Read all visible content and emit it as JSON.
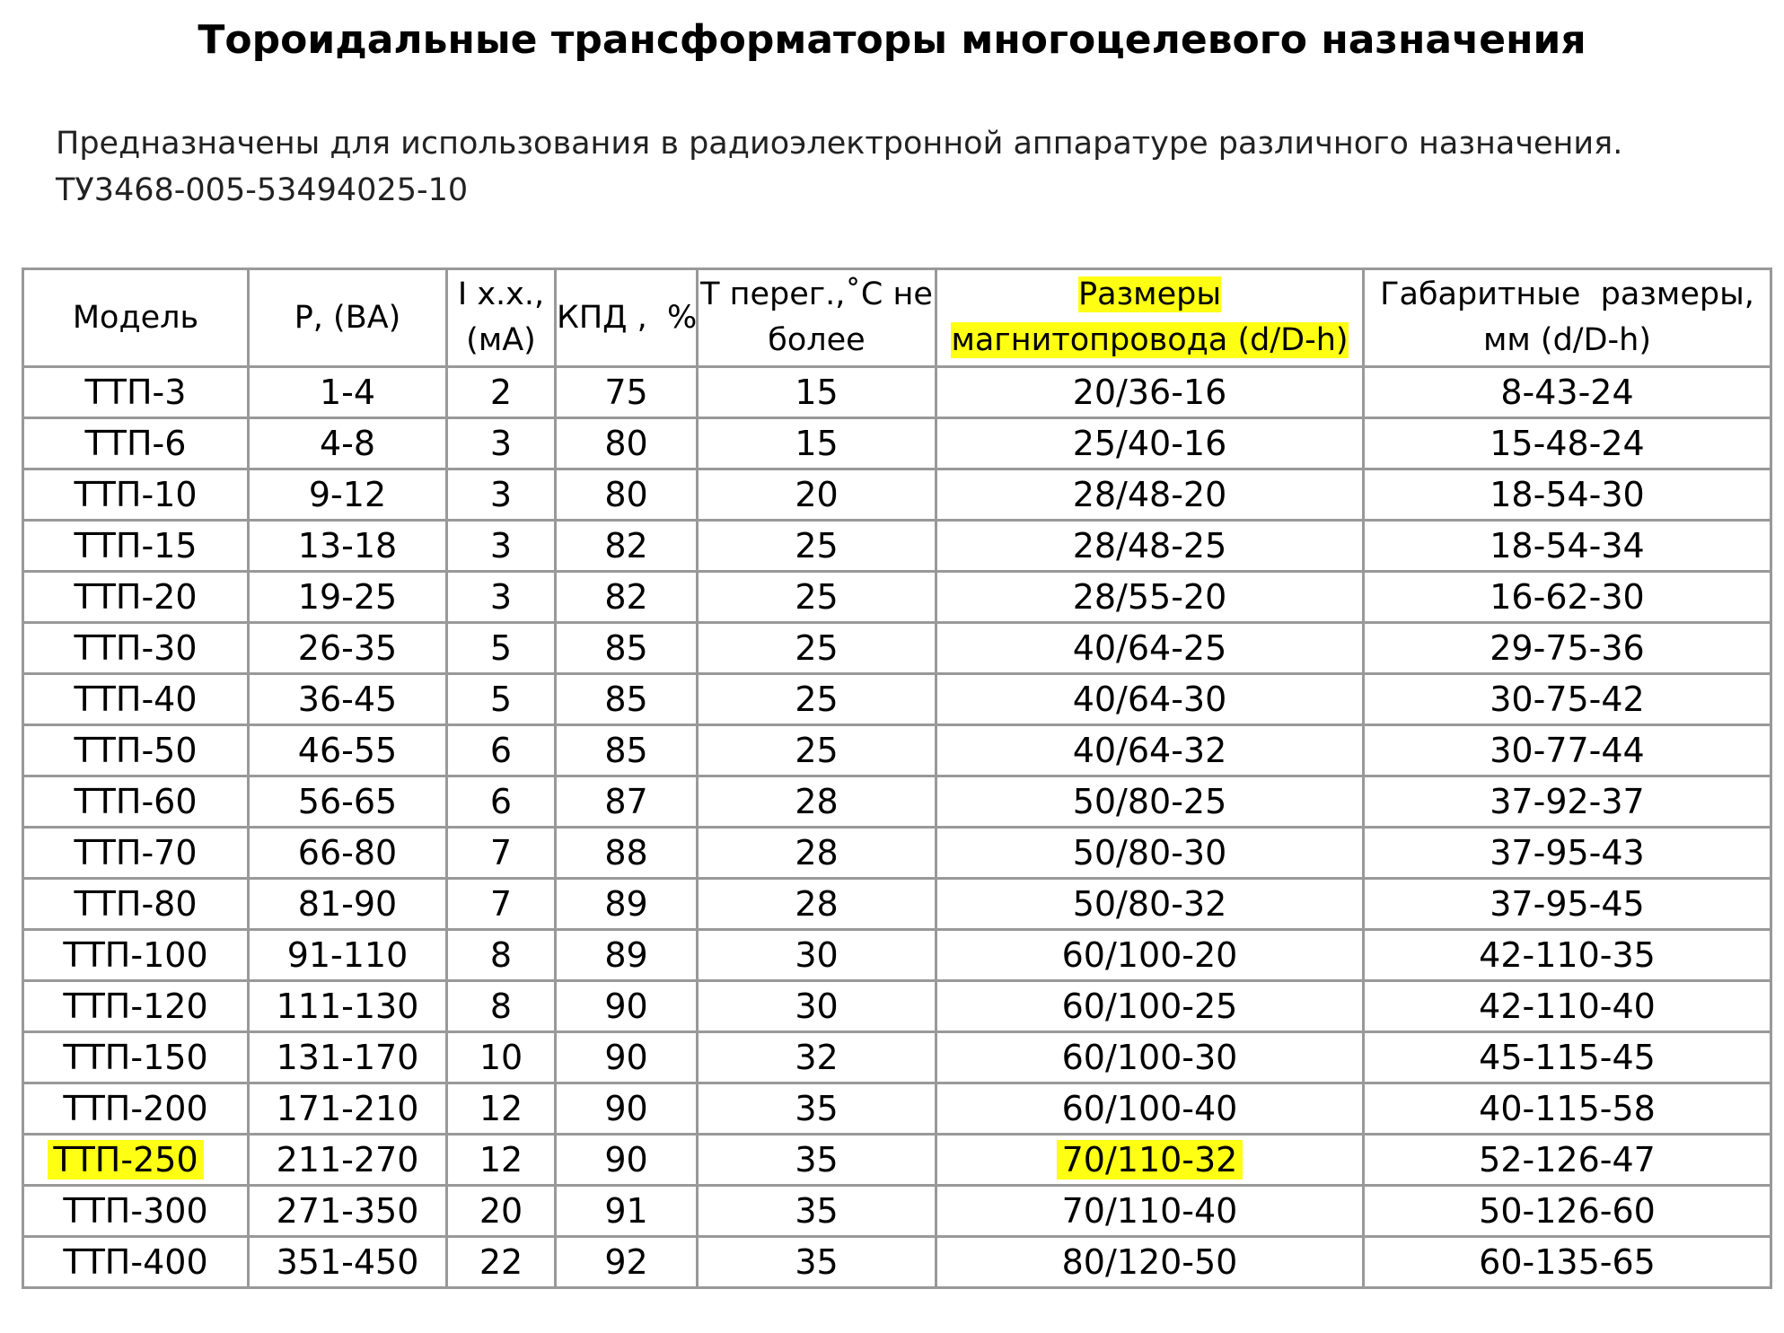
{
  "title": "Тороидальные трансформаторы многоцелевого назначения",
  "description": {
    "line1": "Предназначены для использования в радиоэлектронной аппаратуре различного назначения.",
    "line2": "ТУ3468-005-53494025-10"
  },
  "highlight_color": "#ffff14",
  "table": {
    "headers": {
      "model": "Модель",
      "power": "P, (ВА)",
      "idle_current_line1": "I х.х.,",
      "idle_current_line2": "(мА)",
      "efficiency": "КПД ,  %",
      "overheat_line1": "Т перег.,˚С не",
      "overheat_line2": "более",
      "core_size_line1": "Размеры",
      "core_size_line2": "магнитопровода (d/D-h)",
      "overall_size_line1": "Габаритные  размеры,",
      "overall_size_line2": "мм (d/D-h)"
    },
    "rows": [
      {
        "model": "ТТП-3",
        "power": "1-4",
        "idle_current": "2",
        "efficiency": "75",
        "overheat": "15",
        "core_size": "20/36-16",
        "overall_size": "8-43-24"
      },
      {
        "model": "ТТП-6",
        "power": "4-8",
        "idle_current": "3",
        "efficiency": "80",
        "overheat": "15",
        "core_size": "25/40-16",
        "overall_size": "15-48-24"
      },
      {
        "model": "ТТП-10",
        "power": "9-12",
        "idle_current": "3",
        "efficiency": "80",
        "overheat": "20",
        "core_size": "28/48-20",
        "overall_size": "18-54-30"
      },
      {
        "model": "ТТП-15",
        "power": "13-18",
        "idle_current": "3",
        "efficiency": "82",
        "overheat": "25",
        "core_size": "28/48-25",
        "overall_size": "18-54-34"
      },
      {
        "model": "ТТП-20",
        "power": "19-25",
        "idle_current": "3",
        "efficiency": "82",
        "overheat": "25",
        "core_size": "28/55-20",
        "overall_size": "16-62-30"
      },
      {
        "model": "ТТП-30",
        "power": "26-35",
        "idle_current": "5",
        "efficiency": "85",
        "overheat": "25",
        "core_size": "40/64-25",
        "overall_size": "29-75-36"
      },
      {
        "model": "ТТП-40",
        "power": "36-45",
        "idle_current": "5",
        "efficiency": "85",
        "overheat": "25",
        "core_size": "40/64-30",
        "overall_size": "30-75-42"
      },
      {
        "model": "ТТП-50",
        "power": "46-55",
        "idle_current": "6",
        "efficiency": "85",
        "overheat": "25",
        "core_size": "40/64-32",
        "overall_size": "30-77-44"
      },
      {
        "model": "ТТП-60",
        "power": "56-65",
        "idle_current": "6",
        "efficiency": "87",
        "overheat": "28",
        "core_size": "50/80-25",
        "overall_size": "37-92-37"
      },
      {
        "model": "ТТП-70",
        "power": "66-80",
        "idle_current": "7",
        "efficiency": "88",
        "overheat": "28",
        "core_size": "50/80-30",
        "overall_size": "37-95-43"
      },
      {
        "model": "ТТП-80",
        "power": "81-90",
        "idle_current": "7",
        "efficiency": "89",
        "overheat": "28",
        "core_size": "50/80-32",
        "overall_size": "37-95-45"
      },
      {
        "model": "ТТП-100",
        "power": "91-110",
        "idle_current": "8",
        "efficiency": "89",
        "overheat": "30",
        "core_size": "60/100-20",
        "overall_size": "42-110-35"
      },
      {
        "model": "ТТП-120",
        "power": "111-130",
        "idle_current": "8",
        "efficiency": "90",
        "overheat": "30",
        "core_size": "60/100-25",
        "overall_size": "42-110-40"
      },
      {
        "model": "ТТП-150",
        "power": "131-170",
        "idle_current": "10",
        "efficiency": "90",
        "overheat": "32",
        "core_size": "60/100-30",
        "overall_size": "45-115-45"
      },
      {
        "model": "ТТП-200",
        "power": "171-210",
        "idle_current": "12",
        "efficiency": "90",
        "overheat": "35",
        "core_size": "60/100-40",
        "overall_size": "40-115-58"
      },
      {
        "model": "ТТП-250",
        "power": "211-270",
        "idle_current": "12",
        "efficiency": "90",
        "overheat": "35",
        "core_size": "70/110-32",
        "overall_size": "52-126-47",
        "highlighted": true
      },
      {
        "model": "ТТП-300",
        "power": "271-350",
        "idle_current": "20",
        "efficiency": "91",
        "overheat": "35",
        "core_size": "70/110-40",
        "overall_size": "50-126-60"
      },
      {
        "model": "ТТП-400",
        "power": "351-450",
        "idle_current": "22",
        "efficiency": "92",
        "overheat": "35",
        "core_size": "80/120-50",
        "overall_size": "60-135-65"
      }
    ]
  }
}
